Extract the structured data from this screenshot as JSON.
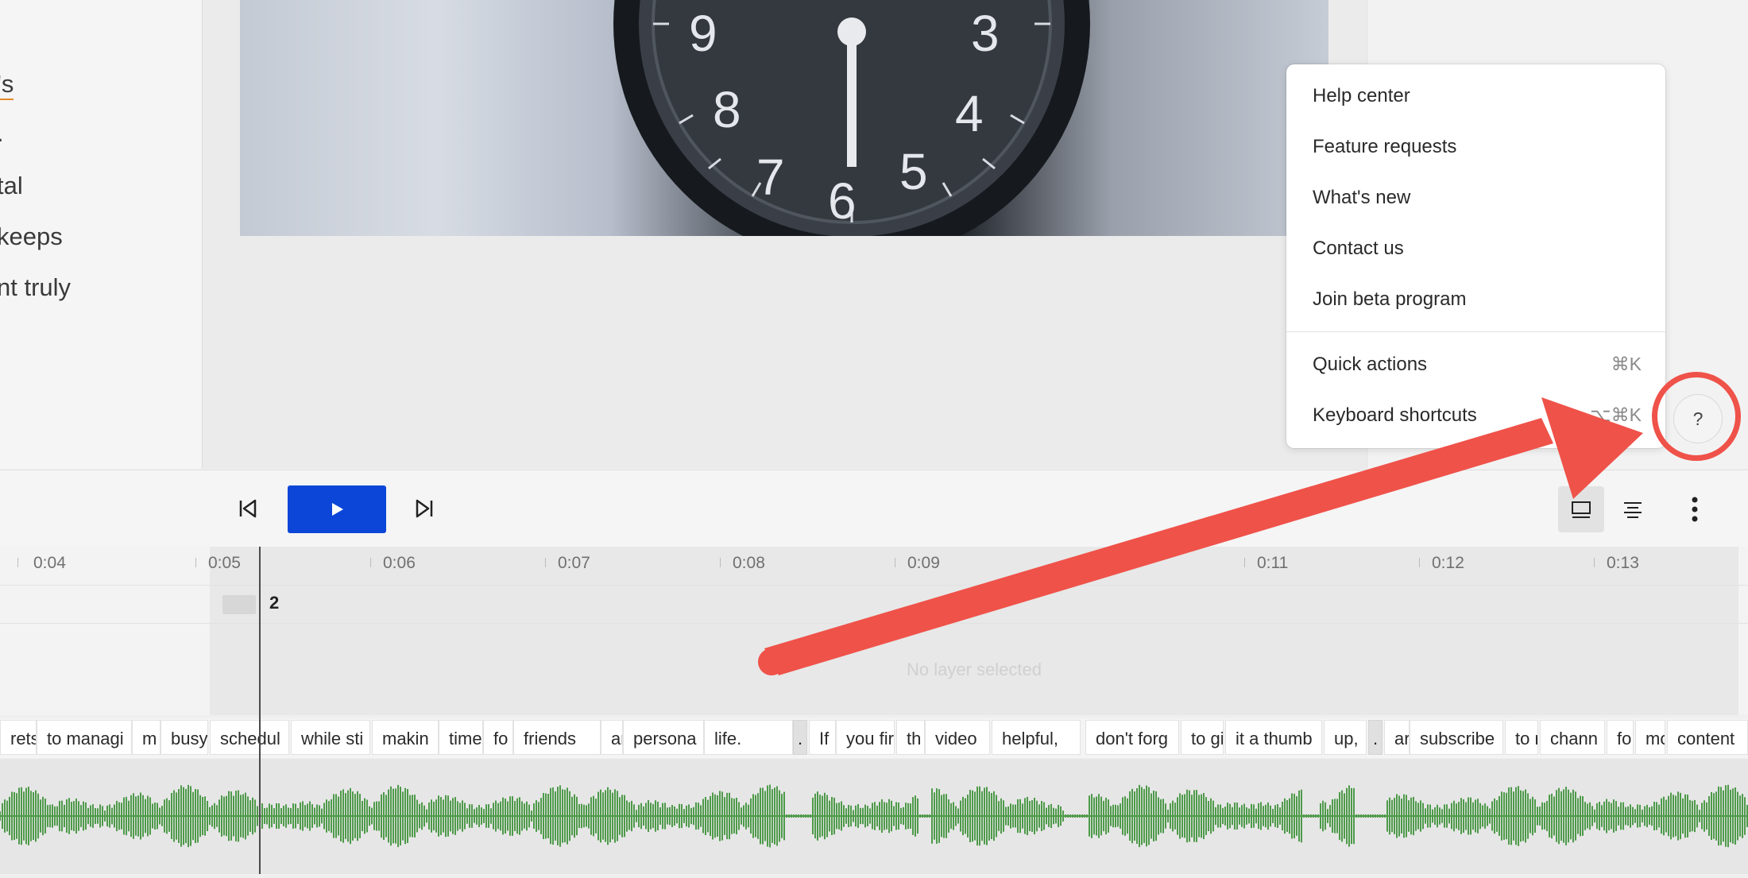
{
  "script": {
    "lines": [
      "'s",
      ".",
      "tal",
      "keeps",
      "nt truly"
    ]
  },
  "help_menu": {
    "items": [
      {
        "label": "Help center"
      },
      {
        "label": "Feature requests"
      },
      {
        "label": "What's new"
      },
      {
        "label": "Contact us"
      },
      {
        "label": "Join beta program"
      }
    ],
    "shortcut_items": [
      {
        "label": "Quick actions",
        "shortcut": "⌘K"
      },
      {
        "label": "Keyboard shortcuts",
        "shortcut": "⌥⌘K"
      }
    ]
  },
  "help_button": {
    "label": "?"
  },
  "icons": {
    "prev": "skip-back-icon",
    "play": "play-icon",
    "next": "skip-forward-icon",
    "layout": "layout-icon",
    "align": "align-center-icon",
    "more": "more-vertical-icon"
  },
  "colors": {
    "accent": "#0b46d8",
    "annotation": "#ef5249",
    "waveform": "#4e9a4a",
    "underline": "#e3882a"
  },
  "timeline": {
    "ticks": [
      "0:04",
      "0:05",
      "0:06",
      "0:07",
      "0:08",
      "0:09",
      "0:11",
      "0:12",
      "0:13"
    ],
    "scene_number": "2",
    "layer_placeholder": "No layer selected",
    "words": [
      "rets",
      "to managi",
      "m",
      "busy",
      "schedul",
      "while sti",
      "makin",
      "time",
      "fo",
      "friends",
      "ar",
      "persona",
      "life.",
      ".",
      "If",
      "you fir",
      "th",
      "video",
      "helpful,",
      "don't forg",
      "to gi",
      "it a thumb",
      "up,",
      ".",
      "ar",
      "subscribe",
      "to r",
      "chann",
      "fo",
      "mo",
      "content"
    ]
  }
}
